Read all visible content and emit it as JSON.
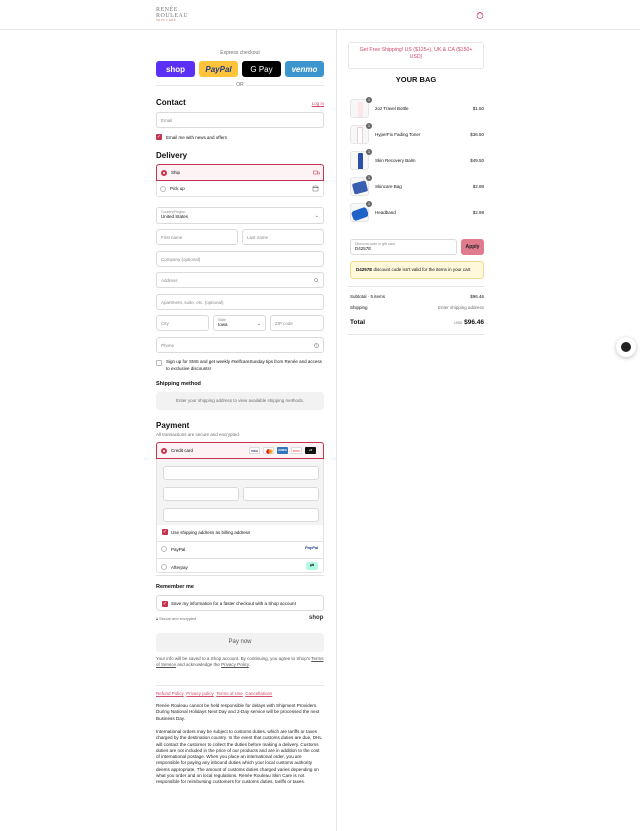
{
  "header": {
    "logo_line1": "RENÉE",
    "logo_line2": "ROULEAU",
    "logo_tagline": "SKIN CARE"
  },
  "express": {
    "label": "Express checkout",
    "shop": "shop",
    "paypal": "PayPal",
    "gpay": "G Pay",
    "venmo": "venmo",
    "or": "OR"
  },
  "contact": {
    "title": "Contact",
    "login": "Log in",
    "email_placeholder": "Email",
    "newsletter": "Email me with news and offers"
  },
  "delivery": {
    "title": "Delivery",
    "ship": "Ship",
    "pickup": "Pick up",
    "country_label": "Country/Region",
    "country_value": "United States",
    "first_name": "First name",
    "last_name": "Last name",
    "company": "Company (optional)",
    "address": "Address",
    "apartment": "Apartment, suite, etc. (optional)",
    "city": "City",
    "state_label": "State",
    "state_value": "Iowa",
    "zip": "ZIP code",
    "phone": "Phone",
    "sms": "Sign up for SMS and get weekly #selfcareSunday tips from Renée and access to exclusive discounts!"
  },
  "shipping_method": {
    "title": "Shipping method",
    "notice": "Enter your shipping address to view available shipping methods."
  },
  "payment": {
    "title": "Payment",
    "subtitle": "All transactions are secure and encrypted.",
    "credit_card": "Credit card",
    "visa": "VISA",
    "amex": "AMEX",
    "discover": "DISC",
    "more": "+5",
    "billing_same": "Use shipping address as billing address",
    "paypal": "PayPal",
    "paypal_logo": "PayPal",
    "afterpay": "Afterpay"
  },
  "remember": {
    "title": "Remember me",
    "save_info": "Save my information for a faster checkout with a Shop account",
    "secure": "Secure and encrypted",
    "shop_logo": "shop"
  },
  "pay_now": "Pay now",
  "legal": {
    "line1": "Your info will be saved to a Shop account. By continuing, you agree to Shop's",
    "terms": "Terms of Service",
    "and": "and acknowledge the",
    "privacy": "Privacy Policy",
    "period": "."
  },
  "footer_links": [
    "Refund Policy",
    "Privacy policy",
    "Terms of Use",
    "Cancellations"
  ],
  "footer_text_1": "Renée Rouleau cannot be held responsible for delays with Shipment Providers. During National Holidays Next Day and 2-Day service will be processed the next Business Day.",
  "footer_text_2": "International orders may be subject to customs duties, which are tariffs or taxes charged by the destination country. In the event that customs duties are due, DHL will contact the customer to collect the duties before making a delivery. Customs duties are not included in the price of our products and are in addition to the cost of international postage. When you place an international order, you are responsible for paying any inbound duties which your local customs authority deems appropriate. The amount of customs duties charged varies depending on what you order and on local regulations. Renée Rouleau Skin Care is not responsible for reimbursing customers for customs duties, tariffs or taxes.",
  "bag": {
    "promo": "Get Free Shipping! US ($125+), UK & CA ($150+ USD)",
    "title": "YOUR BAG",
    "items": [
      {
        "name": "2oz Travel Bottle",
        "price": "$1.50",
        "qty": "1"
      },
      {
        "name": "HyperFix Fading Toner",
        "price": "$36.50",
        "qty": "1"
      },
      {
        "name": "Skin Recovery Balm",
        "price": "$49.50",
        "qty": "1"
      },
      {
        "name": "Skincare Bag",
        "price": "$2.98",
        "qty": "1"
      },
      {
        "name": "Headband",
        "price": "$2.98",
        "qty": "1"
      }
    ],
    "discount_label": "Discount code or gift card",
    "discount_value": "D4257E",
    "apply": "Apply",
    "discount_code": "D4257E",
    "discount_error": "discount code isn't valid for the items in your cart",
    "subtotal_label": "Subtotal · 5 items",
    "subtotal_value": "$96.46",
    "shipping_label": "Shipping",
    "shipping_value": "Enter shipping address",
    "total_label": "Total",
    "currency": "USD",
    "total_value": "$96.46"
  },
  "colors": {
    "accent": "#c5334f",
    "shop": "#5a31f4",
    "paypal": "#ffc439",
    "venmo": "#3d95ce",
    "promo_text": "#d2496a",
    "warning_bg": "#fff8db"
  }
}
